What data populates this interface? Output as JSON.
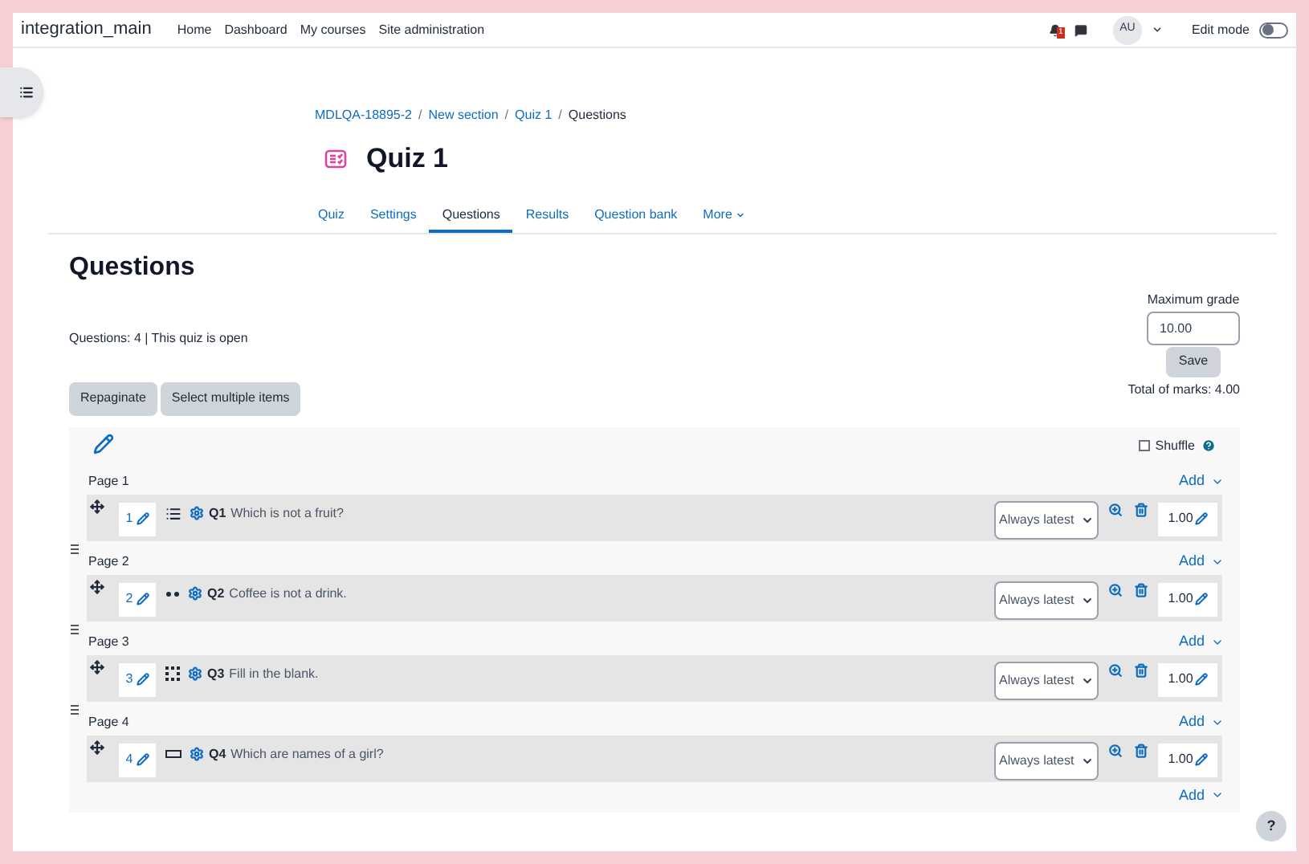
{
  "navbar": {
    "site_name": "integration_main",
    "links": [
      {
        "label": "Home"
      },
      {
        "label": "Dashboard"
      },
      {
        "label": "My courses"
      },
      {
        "label": "Site administration"
      }
    ],
    "notification_count": "1",
    "avatar": "AU",
    "edit_mode": {
      "label": "Edit mode",
      "on": false
    }
  },
  "breadcrumb": [
    {
      "label": "MDLQA-18895-2",
      "link": true
    },
    {
      "separator": "/",
      "label": "New section",
      "link": true
    },
    {
      "separator": "/",
      "label": "Quiz 1",
      "link": true
    },
    {
      "separator": "/",
      "label": "Questions",
      "link": false
    }
  ],
  "title": "Quiz 1",
  "tabs": [
    {
      "label": "Quiz",
      "selected": false
    },
    {
      "label": "Settings",
      "selected": false
    },
    {
      "label": "Questions",
      "selected": true
    },
    {
      "label": "Results",
      "selected": false
    },
    {
      "label": "Question bank",
      "selected": false
    },
    {
      "label": "More",
      "selected": false,
      "dropdown": true
    }
  ],
  "heading": "Questions",
  "summary": "Questions: 4 | This quiz is open",
  "max_grade": {
    "label": "Maximum grade",
    "value": "10.00",
    "save": "Save"
  },
  "actions": [
    "Repaginate",
    "Select multiple items"
  ],
  "total_marks": "Total of marks: 4.00",
  "shuffle": {
    "label": "Shuffle",
    "checked": false
  },
  "pages": [
    {
      "label": "Page 1",
      "add": "Add",
      "questions": [
        {
          "slot": "1",
          "kind": "multichoice",
          "name": "Q1",
          "text": "Which is not a fruit?",
          "version": "Always latest",
          "mark": "1.00"
        }
      ]
    },
    {
      "label": "Page 2",
      "add": "Add",
      "questions": [
        {
          "slot": "2",
          "kind": "truefalse",
          "name": "Q2",
          "text": "Coffee is not a drink.",
          "version": "Always latest",
          "mark": "1.00"
        }
      ]
    },
    {
      "label": "Page 3",
      "add": "Add",
      "questions": [
        {
          "slot": "3",
          "kind": "gapselect",
          "name": "Q3",
          "text": "Fill in the blank.",
          "version": "Always latest",
          "mark": "1.00"
        }
      ]
    },
    {
      "label": "Page 4",
      "add": "Add",
      "questions": [
        {
          "slot": "4",
          "kind": "shortanswer",
          "name": "Q4",
          "text": "Which are names of a girl?",
          "version": "Always latest",
          "mark": "1.00"
        }
      ]
    }
  ],
  "end_add": "Add",
  "help": "?"
}
